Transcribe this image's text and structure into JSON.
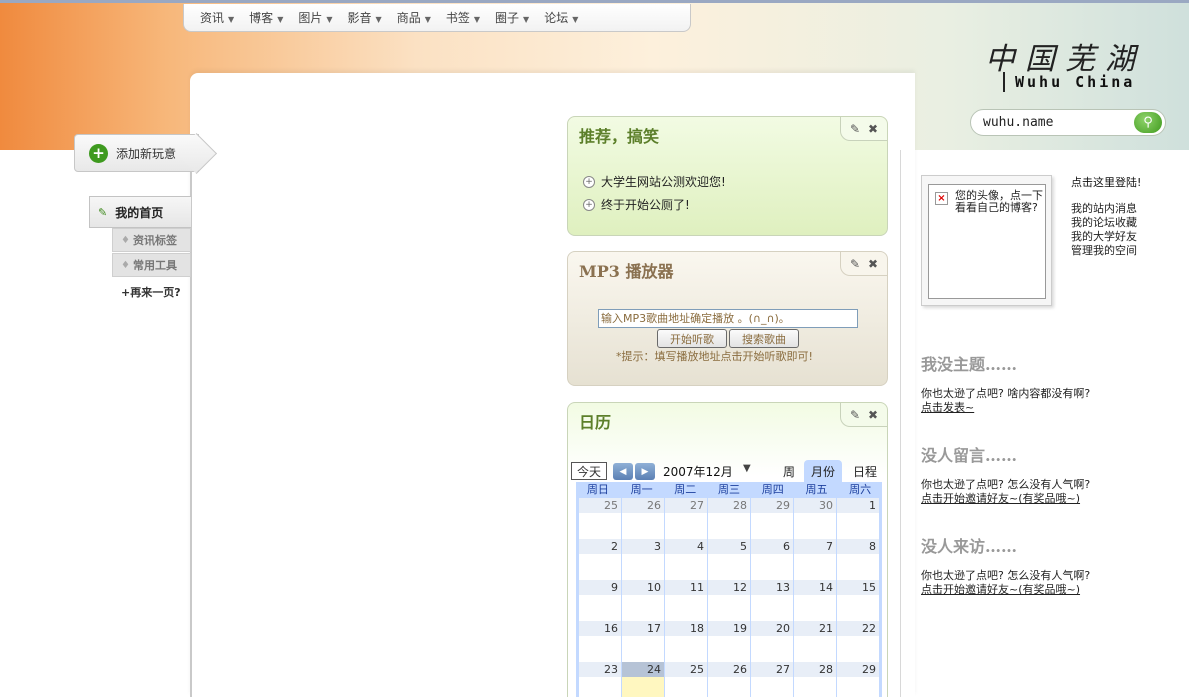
{
  "nav": {
    "items": [
      "资讯",
      "博客",
      "图片",
      "影音",
      "商品",
      "书签",
      "圈子",
      "论坛"
    ]
  },
  "logo": {
    "cn": "中国芜湖",
    "en": "Wuhu China"
  },
  "search": {
    "value": "wuhu.name"
  },
  "left": {
    "add_fun": "添加新玩意",
    "home": "我的首页",
    "sub_items": [
      "资讯标签",
      "常用工具"
    ],
    "more": "再来一页?"
  },
  "widgets": {
    "recommend": {
      "title": "推荐，搞笑",
      "items": [
        "大学生网站公测欢迎您!",
        "终于开始公厕了!"
      ]
    },
    "mp3": {
      "title": "MP3 播放器",
      "input_value": "输入MP3歌曲地址确定播放 。(∩_∩)。",
      "play_button": "开始听歌",
      "search_button": "搜索歌曲",
      "tip": "*提示：填写播放地址点击开始听歌即可!"
    },
    "calendar": {
      "title": "日历",
      "today_button": "今天",
      "month_label": "2007年12月",
      "views": [
        "周",
        "月份",
        "日程"
      ],
      "weekdays": [
        "周日",
        "周一",
        "周二",
        "周三",
        "周四",
        "周五",
        "周六"
      ],
      "weeks": [
        [
          "25",
          "26",
          "27",
          "28",
          "29",
          "30",
          "1"
        ],
        [
          "2",
          "3",
          "4",
          "5",
          "6",
          "7",
          "8"
        ],
        [
          "9",
          "10",
          "11",
          "12",
          "13",
          "14",
          "15"
        ],
        [
          "16",
          "17",
          "18",
          "19",
          "20",
          "21",
          "22"
        ],
        [
          "23",
          "24",
          "25",
          "26",
          "27",
          "28",
          "29"
        ]
      ]
    }
  },
  "right": {
    "avatar_text": "您的头像，点一下看看自己的博客?",
    "login_link": "点击这里登陆!",
    "links": [
      "我的站内消息",
      "我的论坛收藏",
      "我的大学好友",
      "管理我的空间"
    ],
    "sections": [
      {
        "title": "我没主题……",
        "text": "你也太逊了点吧? 啥内容都没有啊?",
        "link": "点击发表~"
      },
      {
        "title": "没人留言……",
        "text": "你也太逊了点吧? 怎么没有人气啊?",
        "link": "点击开始邀请好友~(有奖品哦~)"
      },
      {
        "title": "没人来访……",
        "text": "你也太逊了点吧? 怎么没有人气啊?",
        "link": "点击开始邀请好友~(有奖品哦~)"
      }
    ]
  }
}
